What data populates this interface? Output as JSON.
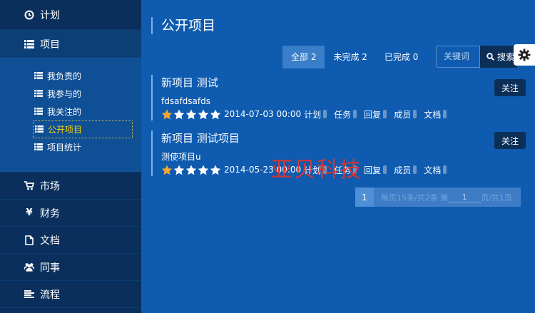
{
  "nav": {
    "plan": "计划",
    "project": "项目",
    "sub": [
      "我负责的",
      "我参与的",
      "我关注的",
      "公开项目",
      "项目统计"
    ],
    "market": "市场",
    "finance": "财务",
    "docs": "文档",
    "colleagues": "同事",
    "workflow": "流程"
  },
  "main": {
    "title": "公开项目",
    "tabs": [
      "全部 2",
      "未完成 2",
      "已完成 0"
    ],
    "search": {
      "placeholder": "关键词",
      "button": "搜索"
    },
    "projects": [
      {
        "title": "新项目 测试",
        "desc": "fdsafdsafds",
        "date": "2014-07-03 00:00",
        "links": [
          "计划",
          "任务",
          "回复",
          "成员",
          "文档"
        ],
        "follow": "关注",
        "rating": 1
      },
      {
        "title": "新项目 测试项目",
        "desc": "测使项目u",
        "date": "2014-05-23 00:00",
        "links": [
          "计划",
          "任务",
          "回复",
          "成员",
          "文档"
        ],
        "follow": "关注",
        "rating": 1
      }
    ],
    "pager": {
      "current": "1",
      "prefix": "每页15条/共2条 第",
      "page": "1",
      "suffix": "页/共1页"
    }
  },
  "watermark": "亚贝科技",
  "colors": {
    "sidebar": "#0a2f5c",
    "main": "#0e5bb0",
    "selected": "#ffd400",
    "star_on": "#f0a830",
    "star_off": "#ffffff"
  }
}
